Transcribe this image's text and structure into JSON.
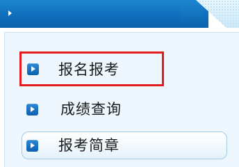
{
  "header": {
    "icon": "arrow-right-icon"
  },
  "menu": {
    "items": [
      {
        "label": "报名报考",
        "icon": "bullet-arrow-icon",
        "highlighted": true
      },
      {
        "label": "成绩查询",
        "icon": "bullet-arrow-icon"
      },
      {
        "label": "报考简章",
        "icon": "bullet-arrow-icon",
        "selected": true
      }
    ]
  },
  "colors": {
    "header": "#0f6fbd",
    "highlight_border": "#e31d1d",
    "icon": "#1a6fc0",
    "menu_background": "#eef7fd"
  }
}
